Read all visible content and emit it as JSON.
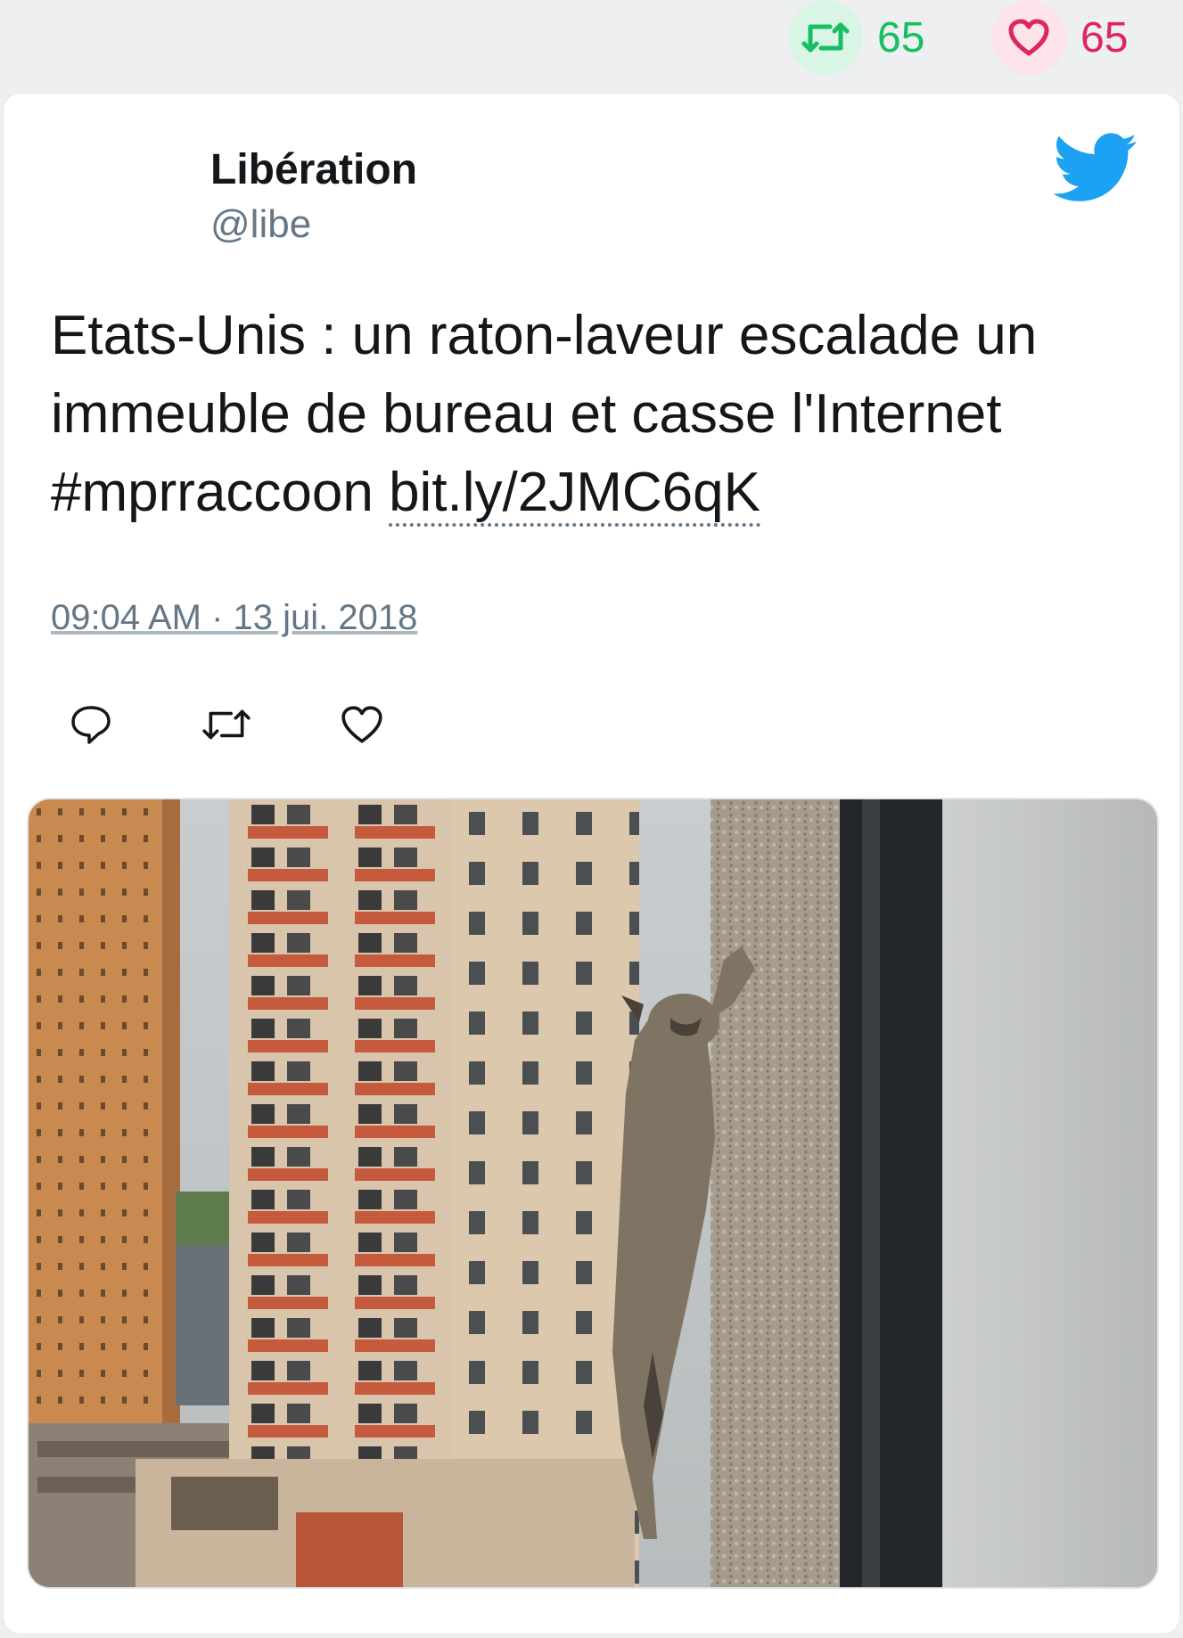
{
  "stats": {
    "retweet_count": "65",
    "like_count": "65",
    "retweet_icon": "retweet-icon",
    "like_icon": "heart-icon",
    "retweet_color": "#17bf63",
    "like_color": "#e0245e"
  },
  "tweet": {
    "author_name": "Libération",
    "author_handle": "@libe",
    "text_before_link": "Etats-Unis : un raton-laveur escalade un immeuble de bureau et casse l'Internet #mprraccoon ",
    "link_text": "bit.ly/2JMC6qK",
    "timestamp": "09:04 AM · 13 jui. 2018",
    "brand_icon": "twitter-bird-icon",
    "brand_color": "#1da1f2"
  },
  "actions": {
    "reply_icon": "reply-icon",
    "retweet_icon": "retweet-icon",
    "like_icon": "heart-icon"
  },
  "media": {
    "image_icon": "photo-raccoon-climbing-building"
  }
}
